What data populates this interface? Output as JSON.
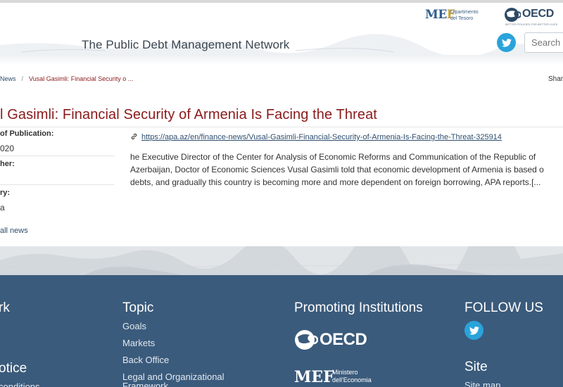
{
  "header": {
    "site_title": "The Public Debt Management Network",
    "mef_logo_mark": "MEF",
    "mef_logo_text_1": "Dipartimento",
    "mef_logo_text_2": "del Tesoro",
    "oecd_logo_text": "OECD",
    "oecd_tagline": "BETTER POLICIES FOR BETTER LIVES",
    "twitter_icon": "twitter-icon",
    "search_placeholder": "Search",
    "brand_color": "#8b1a1a",
    "twitter_color": "#2aa3da"
  },
  "breadcrumb": {
    "news": "News",
    "separator": "/",
    "current": "Vusal Gasimli: Financial Security o ..."
  },
  "share_label": "Shar",
  "article": {
    "title": "l Gasimli: Financial Security of Armenia Is Facing the Threat",
    "date_label": "of Publication:",
    "date_value": "020",
    "publisher_label": "her:",
    "country_label": "ry:",
    "country_value": "a",
    "all_news": "all news",
    "link_icon": "link-icon",
    "source_url": "https://apa.az/en/finance-news/Vusal-Gasimli-Financial-Security-of-Armenia-Is-Facing-the-Threat-325914",
    "body_lines": [
      "he Executive Director of the Center for Analysis of Economic Reforms and Communication of the Republic of",
      "Azerbaijan, Doctor of Economic Sciences Vusal Gasimli told that economic development of Armenia is based o",
      "debts, and gradually this country is becoming more and more dependent on foreign borrowing, APA reports.[..."
    ]
  },
  "footer": {
    "background_color": "#3b5b7c",
    "col1_heading": "rk",
    "col1_heading2": "otice",
    "col1_link": "conditions",
    "topic_heading": "Topic",
    "topic_links": [
      "Goals",
      "Markets",
      "Back Office",
      "Legal and Organizational",
      "Framework"
    ],
    "promoting_heading": "Promoting Institutions",
    "oecd_text": "OECD",
    "mef_mark": "MEF",
    "mef_text_1": "Ministero",
    "mef_text_2": "dell'Economia",
    "follow_heading": "FOLLOW US",
    "site_heading": "Site",
    "site_link": "Site map"
  }
}
